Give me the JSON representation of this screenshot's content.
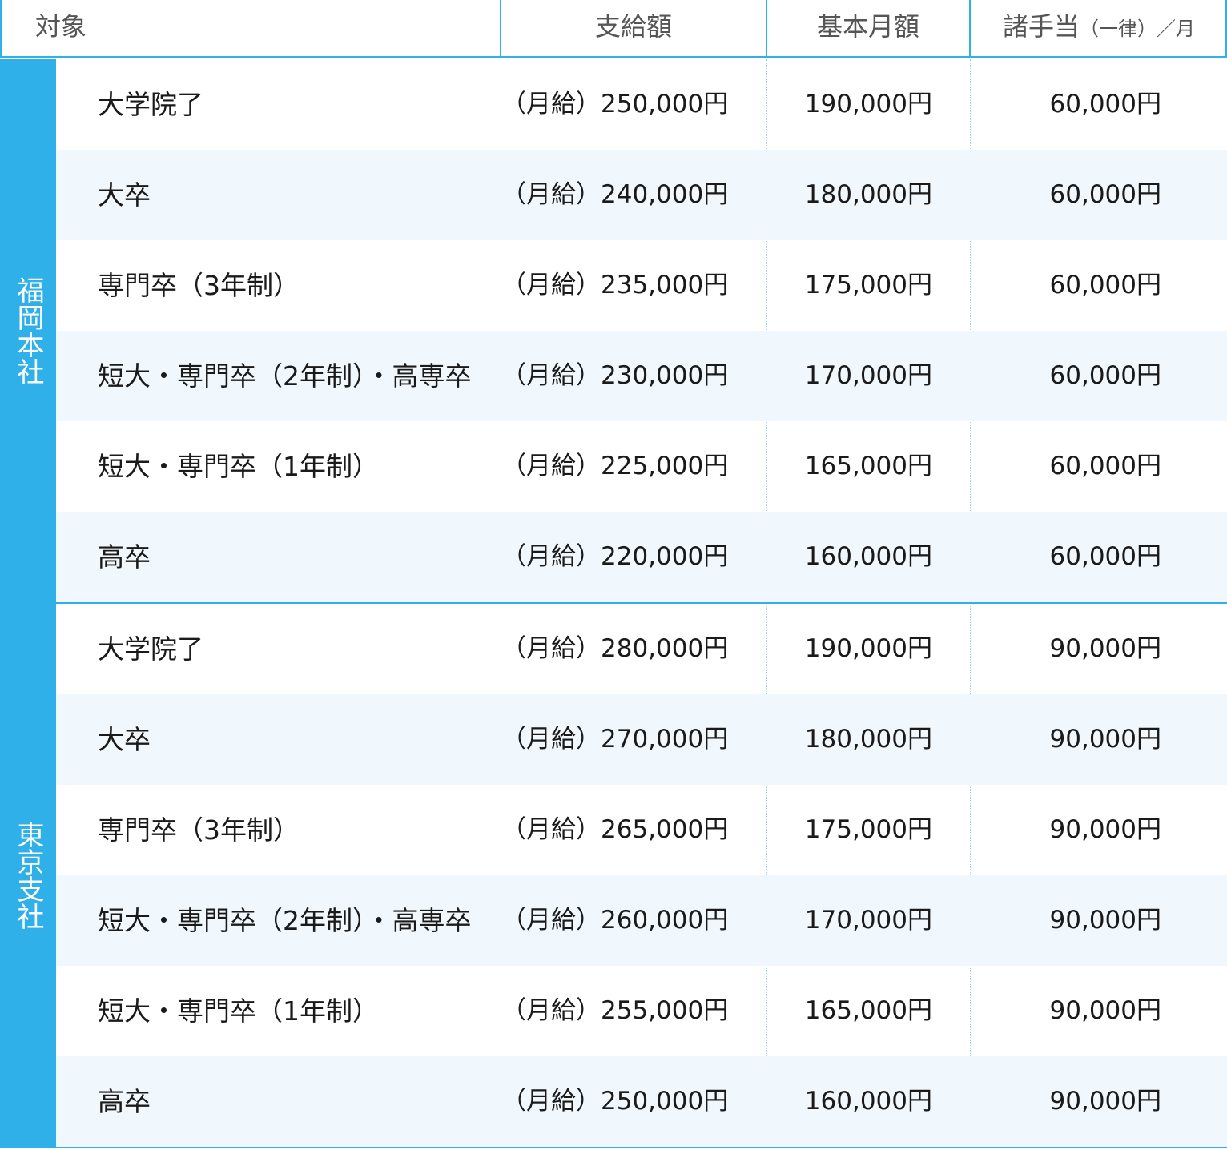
{
  "header": {
    "target": "対象",
    "pay": "支給額",
    "base": "基本月額",
    "allowance_main": "諸手当",
    "allowance_sub": "（一律）／月"
  },
  "groups": [
    {
      "label": "福岡本社",
      "rows": [
        {
          "target": "大学院了",
          "pay": "（月給）250,000円",
          "base": "190,000円",
          "allowance": "60,000円"
        },
        {
          "target": "大卒",
          "pay": "（月給）240,000円",
          "base": "180,000円",
          "allowance": "60,000円"
        },
        {
          "target": "専門卒（3年制）",
          "pay": "（月給）235,000円",
          "base": "175,000円",
          "allowance": "60,000円"
        },
        {
          "target": "短大・専門卒（2年制）・高専卒",
          "pay": "（月給）230,000円",
          "base": "170,000円",
          "allowance": "60,000円"
        },
        {
          "target": "短大・専門卒（1年制）",
          "pay": "（月給）225,000円",
          "base": "165,000円",
          "allowance": "60,000円"
        },
        {
          "target": "高卒",
          "pay": "（月給）220,000円",
          "base": "160,000円",
          "allowance": "60,000円"
        }
      ]
    },
    {
      "label": "東京支社",
      "rows": [
        {
          "target": "大学院了",
          "pay": "（月給）280,000円",
          "base": "190,000円",
          "allowance": "90,000円"
        },
        {
          "target": "大卒",
          "pay": "（月給）270,000円",
          "base": "180,000円",
          "allowance": "90,000円"
        },
        {
          "target": "専門卒（3年制）",
          "pay": "（月給）265,000円",
          "base": "175,000円",
          "allowance": "90,000円"
        },
        {
          "target": "短大・専門卒（2年制）・高専卒",
          "pay": "（月給）260,000円",
          "base": "170,000円",
          "allowance": "90,000円"
        },
        {
          "target": "短大・専門卒（1年制）",
          "pay": "（月給）255,000円",
          "base": "165,000円",
          "allowance": "90,000円"
        },
        {
          "target": "高卒",
          "pay": "（月給）250,000円",
          "base": "160,000円",
          "allowance": "90,000円"
        }
      ]
    }
  ],
  "colors": {
    "accent": "#30b0e8",
    "row_alt": "#f0f8fd",
    "text": "#1a1a1a",
    "header_text": "#555555"
  }
}
